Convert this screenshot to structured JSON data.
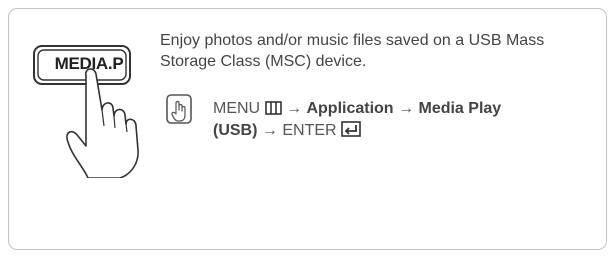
{
  "panel": {
    "button_label": "MEDIA.P",
    "description": "Enjoy photos and/or music files saved on a USB Mass Storage Class (MSC) device.",
    "nav": {
      "menu": "MENU",
      "arrow": "→",
      "application": "Application",
      "media_play": "Media Play",
      "usb": "(USB)",
      "enter": "ENTER"
    },
    "icons": [
      "remote-button-icon",
      "hand-pointer-icon",
      "menu-grid-icon",
      "enter-icon"
    ]
  }
}
